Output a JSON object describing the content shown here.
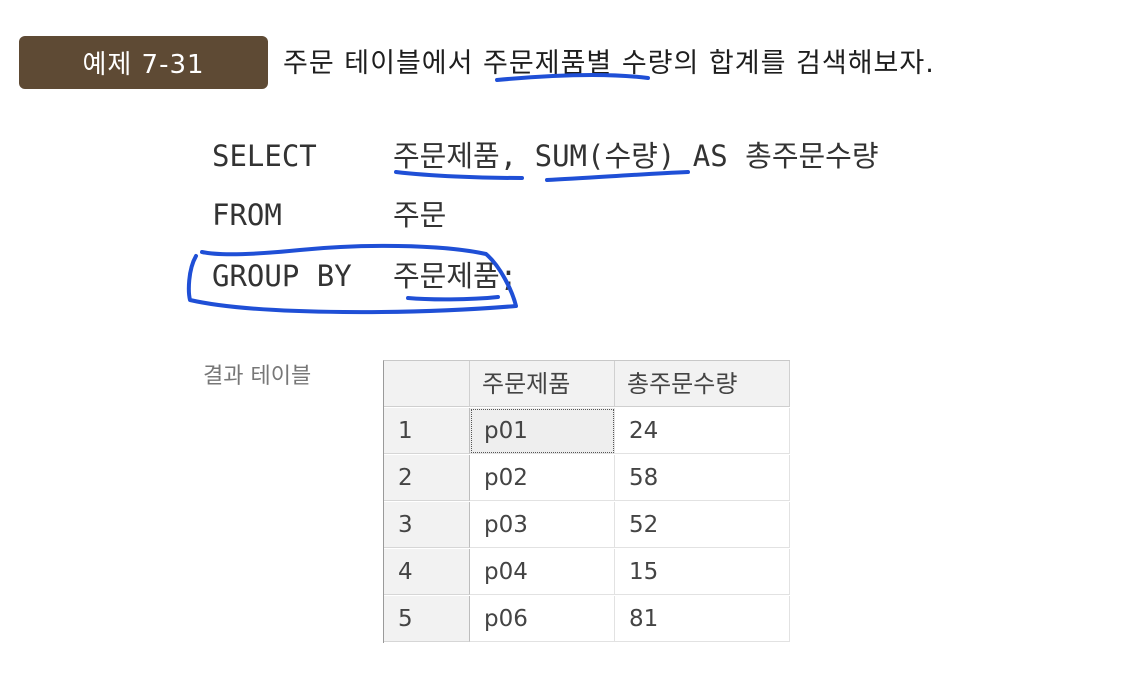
{
  "example": {
    "badge": "예제 7-31",
    "heading": "주문 테이블에서 주문제품별 수량의 합계를 검색해보자."
  },
  "sql": [
    {
      "keyword": "SELECT",
      "argument": "주문제품, SUM(수량) AS 총주문수량"
    },
    {
      "keyword": "FROM",
      "argument": "주문"
    },
    {
      "keyword": "GROUP BY",
      "argument": "주문제품;"
    }
  ],
  "result": {
    "label": "결과 테이블",
    "columns": [
      "주문제품",
      "총주문수량"
    ],
    "rows": [
      {
        "num": "1",
        "product": "p01",
        "total": "24"
      },
      {
        "num": "2",
        "product": "p02",
        "total": "58"
      },
      {
        "num": "3",
        "product": "p03",
        "total": "52"
      },
      {
        "num": "4",
        "product": "p04",
        "total": "15"
      },
      {
        "num": "5",
        "product": "p06",
        "total": "81"
      }
    ],
    "selected_cell": "p01"
  },
  "annotation_color": "#1f4fd6"
}
